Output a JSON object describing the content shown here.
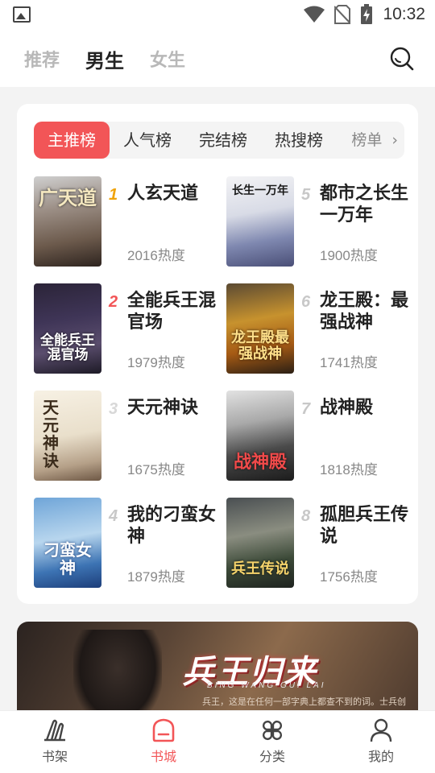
{
  "status_bar": {
    "time": "10:32"
  },
  "header": {
    "tabs": [
      {
        "label": "推荐",
        "active": false
      },
      {
        "label": "男生",
        "active": true
      },
      {
        "label": "女生",
        "active": false
      }
    ]
  },
  "ranking": {
    "tabs": [
      "主推榜",
      "人气榜",
      "完结榜",
      "热搜榜"
    ],
    "active_tab": "主推榜",
    "more_label": "榜单",
    "books": [
      {
        "rank": "1",
        "title": "人玄天道",
        "heat": "2016热度",
        "cover_text": "广天道"
      },
      {
        "rank": "2",
        "title": "全能兵王混官场",
        "heat": "1979热度",
        "cover_text": "全能兵王混官场"
      },
      {
        "rank": "3",
        "title": "天元神诀",
        "heat": "1675热度",
        "cover_text": "天元神诀"
      },
      {
        "rank": "4",
        "title": "我的刁蛮女神",
        "heat": "1879热度",
        "cover_text": "刁蛮女神"
      },
      {
        "rank": "5",
        "title": "都市之长生一万年",
        "heat": "1900热度",
        "cover_text": "长生一万年"
      },
      {
        "rank": "6",
        "title": "龙王殿：最强战神",
        "heat": "1741热度",
        "cover_text": "龙王殿最强战神"
      },
      {
        "rank": "7",
        "title": "战神殿",
        "heat": "1818热度",
        "cover_text": "战神殿"
      },
      {
        "rank": "8",
        "title": "孤胆兵王传说",
        "heat": "1756热度",
        "cover_text": "兵王传说"
      }
    ]
  },
  "banner": {
    "title": "兵王归来",
    "subtitle": "BING WANG GUI LAI",
    "description": "兵王，这是在任何一部字典上都查不到的词。士兵创"
  },
  "bottom_nav": {
    "items": [
      {
        "label": "书架",
        "active": false
      },
      {
        "label": "书城",
        "active": true
      },
      {
        "label": "分类",
        "active": false
      },
      {
        "label": "我的",
        "active": false
      }
    ]
  },
  "colors": {
    "accent": "#f25557",
    "rank1": "#f0a30a"
  }
}
